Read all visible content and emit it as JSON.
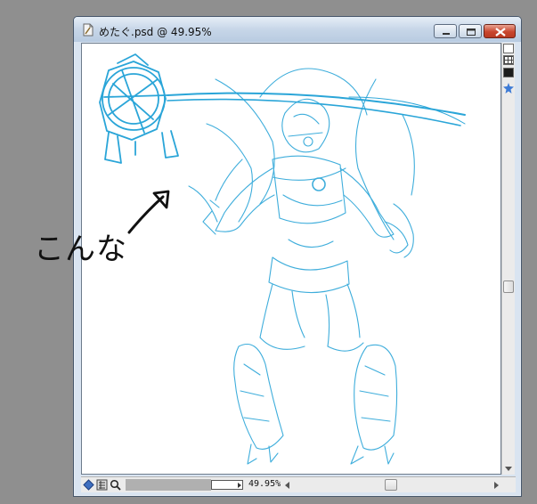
{
  "window": {
    "title": "めたぐ.psd @ 49.95%",
    "icon": "document-icon",
    "controls": [
      "minimize-icon",
      "maximize-icon",
      "close-icon"
    ]
  },
  "status": {
    "zoom": "49.95%"
  },
  "annotation": {
    "text": "こんな"
  },
  "colors": {
    "sketch": "#2aa5d8",
    "titlebar": "#c7d6e8",
    "close": "#c9462e",
    "desktop": "#8f8f8f"
  }
}
